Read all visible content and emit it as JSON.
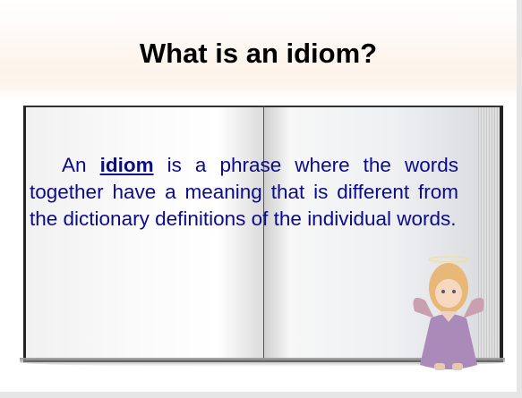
{
  "slide": {
    "title": "What is an idiom?",
    "body": {
      "prefix": "An",
      "term": "idiom",
      "suffix": "is a phrase where the words together have a meaning that is different from the dictionary definitions of the individual words."
    }
  },
  "colors": {
    "text": "#0b0b8c",
    "title": "#000000"
  }
}
